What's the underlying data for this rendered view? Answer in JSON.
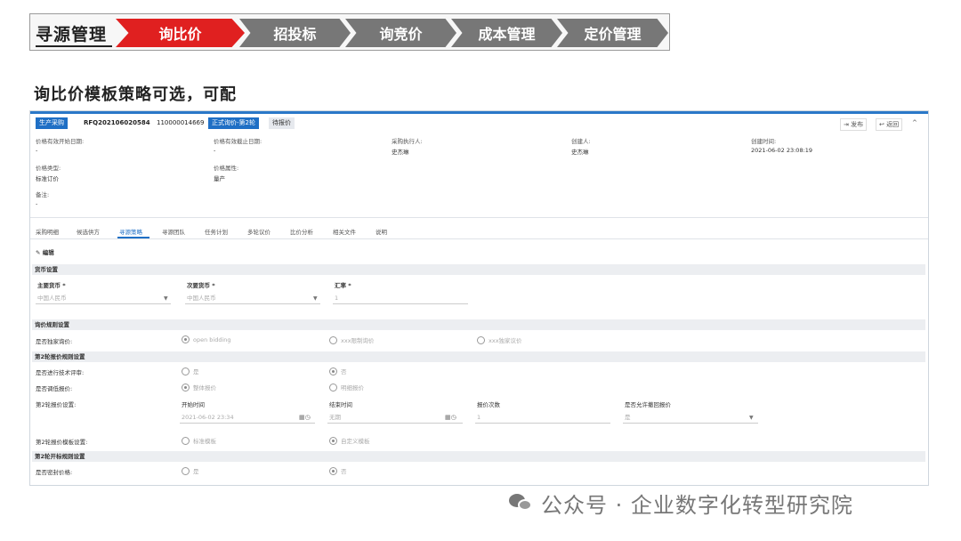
{
  "process_nav": {
    "first": "寻源管理",
    "steps": [
      {
        "label": "询比价",
        "state": "active"
      },
      {
        "label": "招投标",
        "state": "inactive"
      },
      {
        "label": "询竞价",
        "state": "inactive"
      },
      {
        "label": "成本管理",
        "state": "inactive"
      },
      {
        "label": "定价管理",
        "state": "inactive"
      }
    ]
  },
  "page_heading": "询比价模板策略可选，可配",
  "app": {
    "badges": {
      "type": "生产采购",
      "rfq_no": "RFQ202106020584",
      "number": "110000014669",
      "status": "正式询价-第2轮",
      "pending": "待报价"
    },
    "toolbar": {
      "publish": "发布",
      "back": "返回",
      "collapse": "^"
    },
    "meta": {
      "price_start_label": "价格有效开始日期:",
      "price_start_value": "-",
      "price_end_label": "价格有效截止日期:",
      "price_end_value": "-",
      "executor_label": "采购执行人:",
      "executor_value": "史杰琳",
      "creator_label": "创建人:",
      "creator_value": "史杰琳",
      "created_label": "创建时间:",
      "created_value": "2021-06-02 23:08:19",
      "price_type_label": "价格类型:",
      "price_type_value": "标准订价",
      "price_attr_label": "价格属性:",
      "price_attr_value": "量产",
      "remark_label": "备注:",
      "remark_value": "-"
    },
    "tabs": [
      "采购明细",
      "候选供方",
      "寻源策略",
      "寻源团队",
      "任务计划",
      "多轮议价",
      "比价分析",
      "相关文件",
      "说明"
    ],
    "active_tab": "寻源策略",
    "edit_label": "编辑",
    "sections": {
      "currency": "货币设置",
      "inquiry_rules": "询价规则设置",
      "round2_quote": "第2轮报价规则设置",
      "round2_open": "第2轮开标规则设置"
    },
    "currency": {
      "main_label": "主要货币 *",
      "main_value": "中国人民币",
      "secondary_label": "次要货币 *",
      "secondary_value": "中国人民币",
      "rate_label": "汇率 *",
      "rate_value": "1"
    },
    "inquiry": {
      "label": "是否独家询价:",
      "opt1": "open bidding",
      "opt2": "xxx限制询价",
      "opt3": "xxx独家议价"
    },
    "round2": {
      "tech_review_label": "是否进行技术评审:",
      "tech_yes": "是",
      "tech_no": "否",
      "quote_method_label": "是否调低报价:",
      "quote_opt1": "整体报价",
      "quote_opt2": "明细报价",
      "quote_setting_label": "第2轮报价设置:",
      "start_time_label": "开始时间",
      "start_time_value": "2021-06-02 23:34",
      "end_time_label": "结束时间",
      "end_time_value": "无期",
      "quote_count_label": "报价次数",
      "quote_count_value": "1",
      "allow_label": "是否允许撤回报价",
      "allow_value": "是",
      "template_label": "第2轮报价模板设置:",
      "template_opt1": "标准模板",
      "template_opt2": "自定义模板"
    },
    "open": {
      "label": "是否密封价格:",
      "yes": "是",
      "no": "否"
    }
  },
  "watermark": "公众号 · 企业数字化转型研究院"
}
